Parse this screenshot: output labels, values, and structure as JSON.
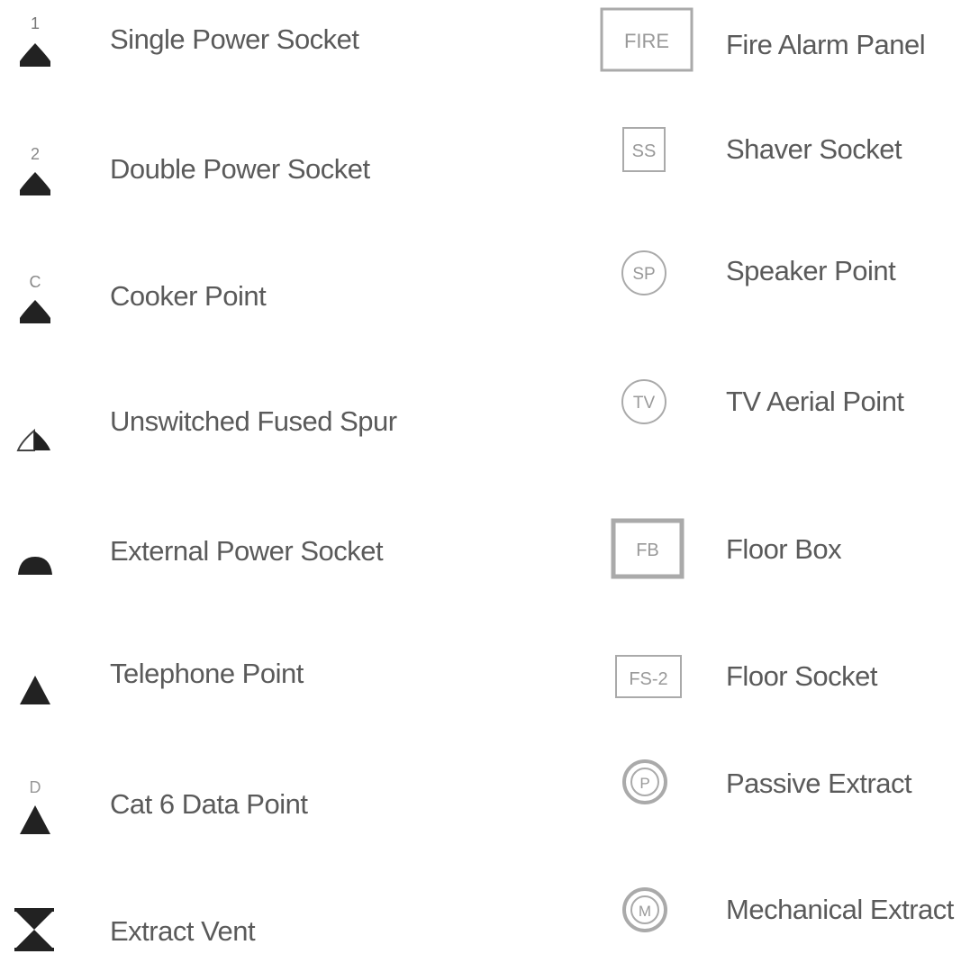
{
  "left_column": [
    {
      "symbol_name": "single-power-socket-icon",
      "mark": "1",
      "label": "Single Power Socket"
    },
    {
      "symbol_name": "double-power-socket-icon",
      "mark": "2",
      "label": "Double Power Socket"
    },
    {
      "symbol_name": "cooker-point-icon",
      "mark": "C",
      "label": "Cooker Point"
    },
    {
      "symbol_name": "unswitched-fused-spur-icon",
      "mark": "",
      "label": "Unswitched Fused Spur"
    },
    {
      "symbol_name": "external-power-socket-icon",
      "mark": "",
      "label": "External Power Socket"
    },
    {
      "symbol_name": "telephone-point-icon",
      "mark": "",
      "label": "Telephone Point"
    },
    {
      "symbol_name": "cat6-data-point-icon",
      "mark": "D",
      "label": "Cat 6 Data Point"
    },
    {
      "symbol_name": "extract-vent-icon",
      "mark": "",
      "label": "Extract Vent"
    }
  ],
  "right_column": [
    {
      "symbol_name": "fire-alarm-panel-icon",
      "mark": "FIRE",
      "label": "Fire Alarm Panel"
    },
    {
      "symbol_name": "shaver-socket-icon",
      "mark": "SS",
      "label": "Shaver Socket"
    },
    {
      "symbol_name": "speaker-point-icon",
      "mark": "SP",
      "label": "Speaker Point"
    },
    {
      "symbol_name": "tv-aerial-point-icon",
      "mark": "TV",
      "label": "TV Aerial Point"
    },
    {
      "symbol_name": "floor-box-icon",
      "mark": "FB",
      "label": "Floor Box"
    },
    {
      "symbol_name": "floor-socket-icon",
      "mark": "FS-2",
      "label": "Floor Socket"
    },
    {
      "symbol_name": "passive-extract-icon",
      "mark": "P",
      "label": "Passive Extract"
    },
    {
      "symbol_name": "mechanical-extract-icon",
      "mark": "M",
      "label": "Mechanical Extract"
    }
  ],
  "colors": {
    "symbol_fill": "#222222",
    "symbol_stroke": "#999999",
    "label_text": "#5a5a5a"
  }
}
